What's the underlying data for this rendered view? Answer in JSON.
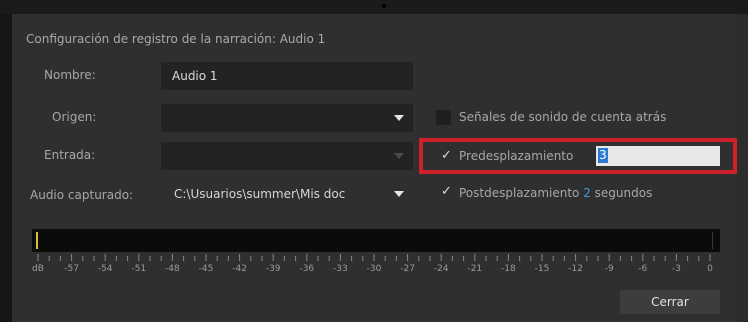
{
  "dialog": {
    "title": "Configuración de registro de la narración: Audio 1"
  },
  "form": {
    "name_label": "Nombre:",
    "name_value": "Audio 1",
    "origin_label": "Origen:",
    "origin_value": "",
    "input_label": "Entrada:",
    "input_value": "",
    "captured_label": "Audio capturado:",
    "captured_value": "C:\\Usuarios\\summer\\Mis doc"
  },
  "options": {
    "countdown_label": "Señales de sonido de cuenta atrás",
    "countdown_checked": false,
    "preroll_label": "Predesplazamiento",
    "preroll_checked": true,
    "preroll_value": "3",
    "postroll_label": "Postdesplazamiento",
    "postroll_checked": true,
    "postroll_value": "2",
    "postroll_unit": "segundos",
    "check_glyph": "✓"
  },
  "meter": {
    "scale_labels": [
      "dB",
      "-57",
      "-54",
      "-51",
      "-48",
      "-45",
      "-42",
      "-39",
      "-36",
      "-33",
      "-30",
      "-27",
      "-24",
      "-21",
      "-18",
      "-15",
      "-12",
      "-9",
      "-6",
      "-3",
      "0"
    ],
    "peak_color": "#d8c03a"
  },
  "buttons": {
    "close_label": "Cerrar"
  },
  "colors": {
    "highlight": "#d0202a",
    "accent": "#3d9bdc",
    "background": "#2f2f2f",
    "field": "#232323"
  }
}
